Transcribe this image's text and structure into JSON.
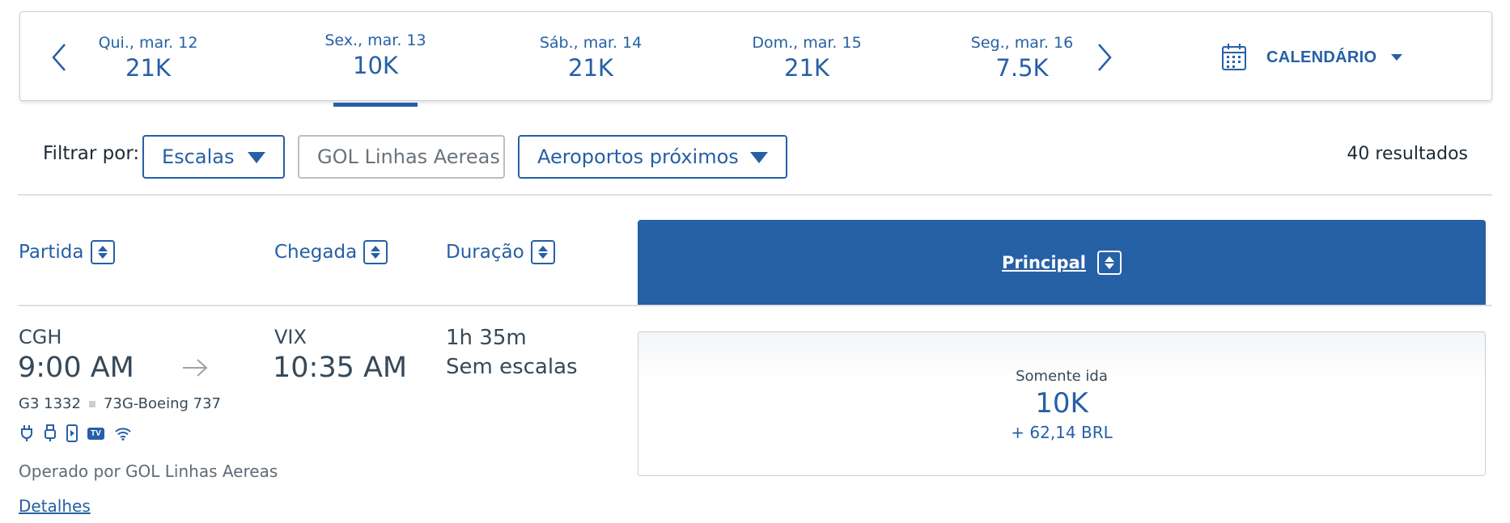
{
  "date_bar": {
    "dates": [
      {
        "label": "Qui., mar. 12",
        "price": "21K"
      },
      {
        "label": "Sex., mar. 13",
        "price": "10K",
        "selected": true
      },
      {
        "label": "Sáb., mar. 14",
        "price": "21K"
      },
      {
        "label": "Dom., mar. 15",
        "price": "21K"
      },
      {
        "label": "Seg., mar. 16",
        "price": "7.5K"
      }
    ],
    "prev_icon": "chevron-left-icon",
    "next_icon": "chevron-right-icon",
    "calendar_label": "CALENDÁRIO",
    "calendar_icon": "calendar-icon"
  },
  "filters": {
    "label": "Filtrar por:",
    "stops": "Escalas",
    "airline": "GOL Linhas Aereas",
    "nearby": "Aeroportos próximos",
    "results": "40 resultados"
  },
  "columns": {
    "departure": "Partida",
    "arrival": "Chegada",
    "duration": "Duração",
    "principal": "Principal"
  },
  "flight": {
    "origin": "CGH",
    "depart_time": "9:00 AM",
    "destination": "VIX",
    "arrive_time": "10:35 AM",
    "duration": "1h 35m",
    "stops": "Sem escalas",
    "flight_number": "G3 1332",
    "aircraft": "73G-Boeing 737",
    "amenities": [
      "power-outlet-icon",
      "usb-icon",
      "mobile-device-icon",
      "tv-icon",
      "wifi-icon"
    ],
    "tv_text": "TV",
    "operated_by": "Operado por GOL Linhas Aereas",
    "details_link": "Detalhes",
    "fare": {
      "label": "Somente ida",
      "miles": "10K",
      "taxes": "+ 62,14 BRL"
    }
  },
  "colors": {
    "accent": "#2660a5",
    "text": "#36495a",
    "divider": "#dde1e5"
  }
}
